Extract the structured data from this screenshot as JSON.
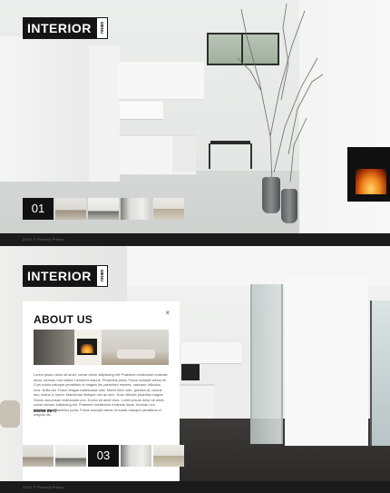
{
  "brand": {
    "name": "INTERIOR",
    "tag": "MENU"
  },
  "slide1": {
    "number": "01",
    "thumbnails": [
      "thumb-living",
      "thumb-kitchen",
      "thumb-room",
      "thumb-lounge"
    ]
  },
  "slide2": {
    "number": "03",
    "thumbnails_left": [
      "thumb-living",
      "thumb-kitchen"
    ],
    "thumbnails_right": [
      "thumb-room",
      "thumb-lounge"
    ]
  },
  "about": {
    "title": "ABOUT US",
    "close": "×",
    "body": "Lorem ipsum dolor sit amet, conse ctetur adipiscing elit. Praesent vestibulum molestie lacus. Aenean non ullamc hendrerit mauris. Phasellus porta. Fusce suscipit varius mi. Cum sociis natoque penatibus et magnis dis parturient montes, nascetur ridiculus mus. Nulla dui. Fusce feugiat malesuada odio. Morbi nunc odio, gravida at, cursus nec, luctus a, lorem. Maecenas tristique orci ac sem. Duis ultricies pharetra magna. Donec accumsan malesuada orci. Donec sit amet eros. Lorem ipsum dolor sit amet, conse ctetuer adipiscing elit. Praesent vestibulum molestie lacus. Aenean non ullamcorper. Phasellus porta. Fusce suscipit varius mi sociis natoque penatibus et magnis dis.",
    "more": "MORE INFO"
  },
  "footer": {
    "copyright": "2012 © Privacy Policy"
  }
}
